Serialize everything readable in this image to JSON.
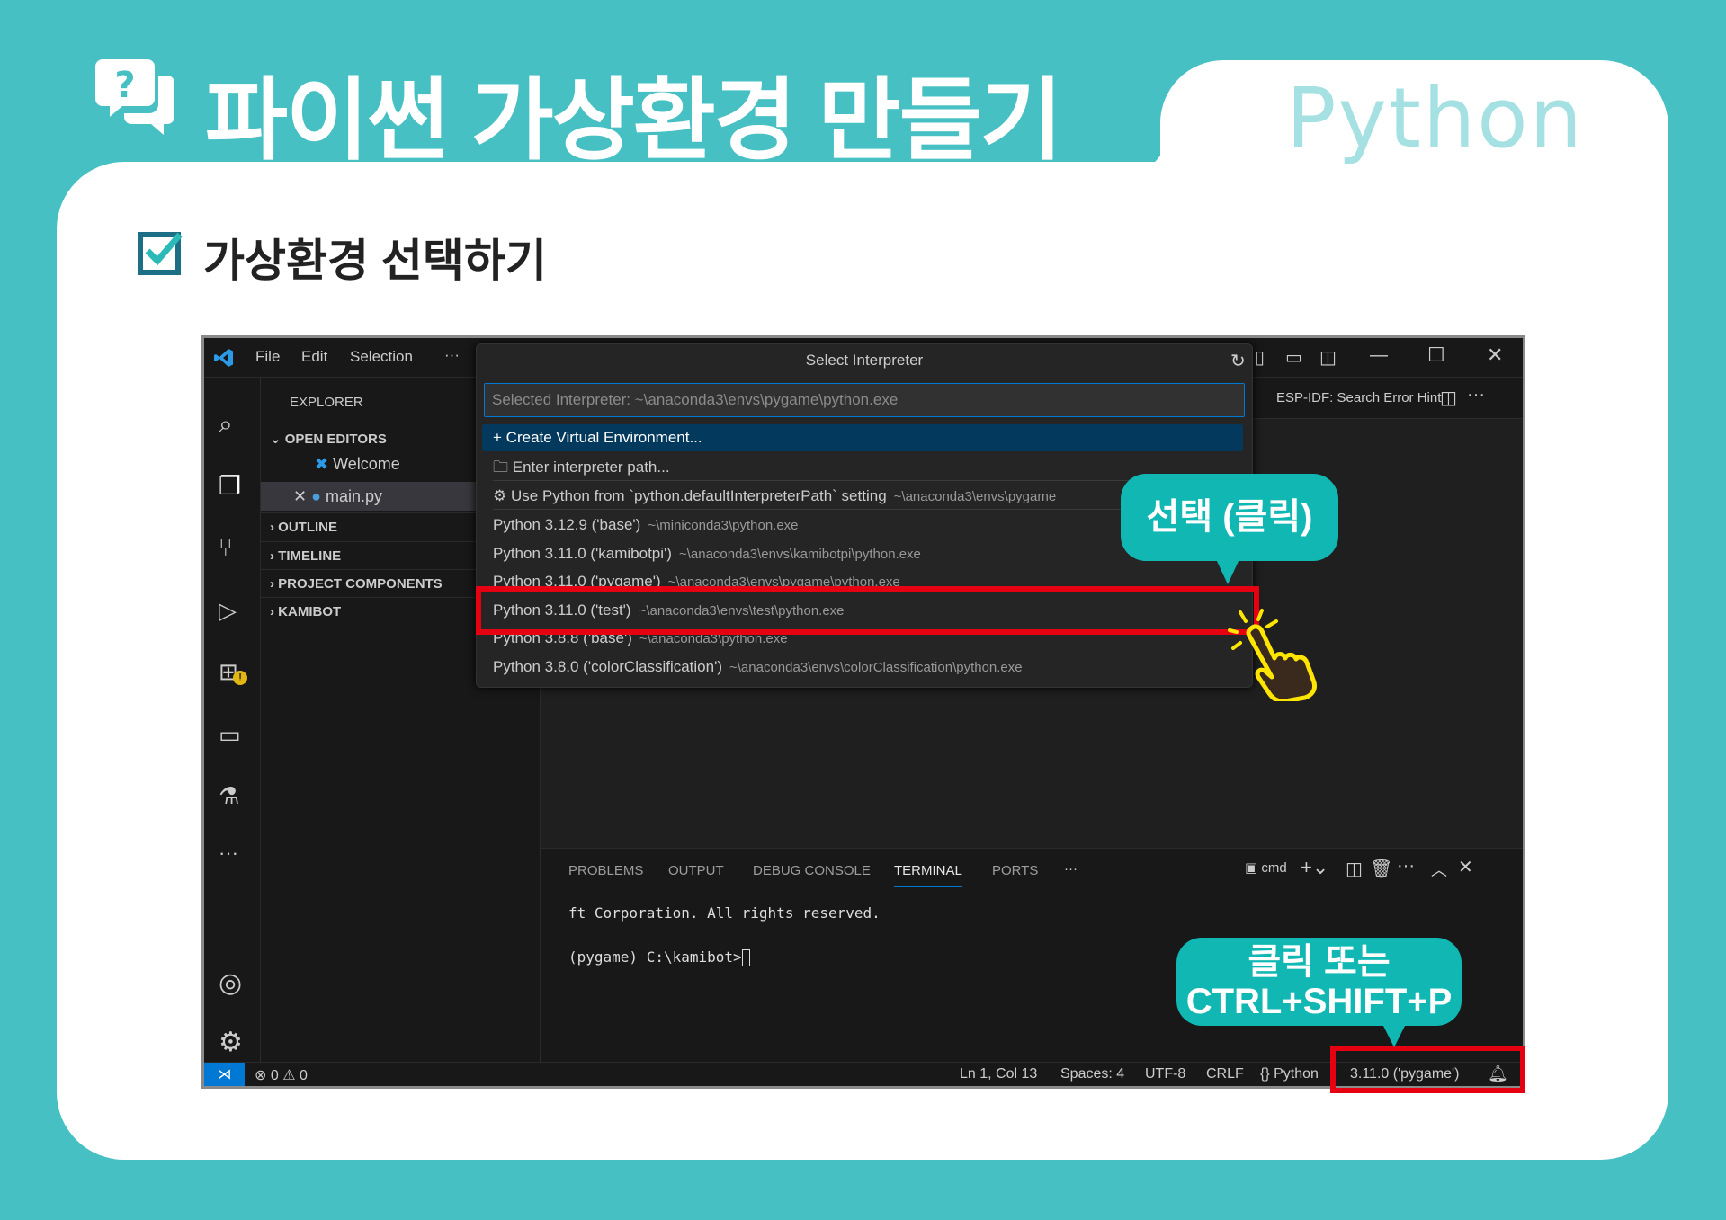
{
  "header": {
    "title": "파이썬 가상환경 만들기",
    "language_tag": "Python",
    "icon": "question-chat-icon"
  },
  "section": {
    "title": "가상환경 선택하기",
    "icon": "checkbox-icon"
  },
  "vscode": {
    "menu": [
      "File",
      "Edit",
      "Selection",
      "···"
    ],
    "explorer": {
      "title": "EXPLORER",
      "open_editors": "OPEN EDITORS",
      "files": [
        "Welcome",
        "main.py"
      ],
      "sections": [
        "OUTLINE",
        "TIMELINE",
        "PROJECT COMPONENTS",
        "KAMIBOT"
      ]
    },
    "editor_tab": "ESP-IDF: Search Error Hint",
    "palette": {
      "title": "Select Interpreter",
      "placeholder": "Selected Interpreter: ~\\anaconda3\\envs\\pygame\\python.exe",
      "actions": [
        {
          "label": "Create Virtual Environment...",
          "icon": "plus-icon"
        },
        {
          "label": "Enter interpreter path...",
          "icon": "folder-icon"
        },
        {
          "label": "Use Python from `python.defaultInterpreterPath` setting",
          "detail": "~\\anaconda3\\envs\\pygame",
          "icon": "gear-icon"
        }
      ],
      "interpreters": [
        {
          "label": "Python 3.12.9 ('base')",
          "path": "~\\miniconda3\\python.exe"
        },
        {
          "label": "Python 3.11.0 ('kamibotpi')",
          "path": "~\\anaconda3\\envs\\kamibotpi\\python.exe"
        },
        {
          "label": "Python 3.11.0 ('pygame')",
          "path": "~\\anaconda3\\envs\\pygame\\python.exe"
        },
        {
          "label": "Python 3.11.0 ('test')",
          "path": "~\\anaconda3\\envs\\test\\python.exe"
        },
        {
          "label": "Python 3.8.8 ('base')",
          "path": "~\\anaconda3\\python.exe"
        },
        {
          "label": "Python 3.8.0 ('colorClassification')",
          "path": "~\\anaconda3\\envs\\colorClassification\\python.exe"
        }
      ]
    },
    "panel": {
      "tabs": [
        "PROBLEMS",
        "OUTPUT",
        "DEBUG CONSOLE",
        "TERMINAL",
        "PORTS",
        "···"
      ],
      "active_tab": "TERMINAL",
      "shell": "cmd",
      "lines": [
        "ft Corporation. All rights reserved.",
        "(pygame) C:\\kamibot>"
      ]
    },
    "status": {
      "errors": "0",
      "warnings": "0",
      "position": "Ln 1, Col 13",
      "spaces": "Spaces: 4",
      "encoding": "UTF-8",
      "eol": "CRLF",
      "language": "{} Python",
      "interpreter": "3.11.0 ('pygame')"
    }
  },
  "callouts": {
    "select": "선택 (클릭)",
    "shortcut_line1": "클릭 또는",
    "shortcut_line2": "CTRL+SHIFT+P"
  },
  "colors": {
    "background": "#47c0c4",
    "callout": "#11b7b3",
    "highlight_box": "#e50012",
    "accent": "#0078d4"
  }
}
